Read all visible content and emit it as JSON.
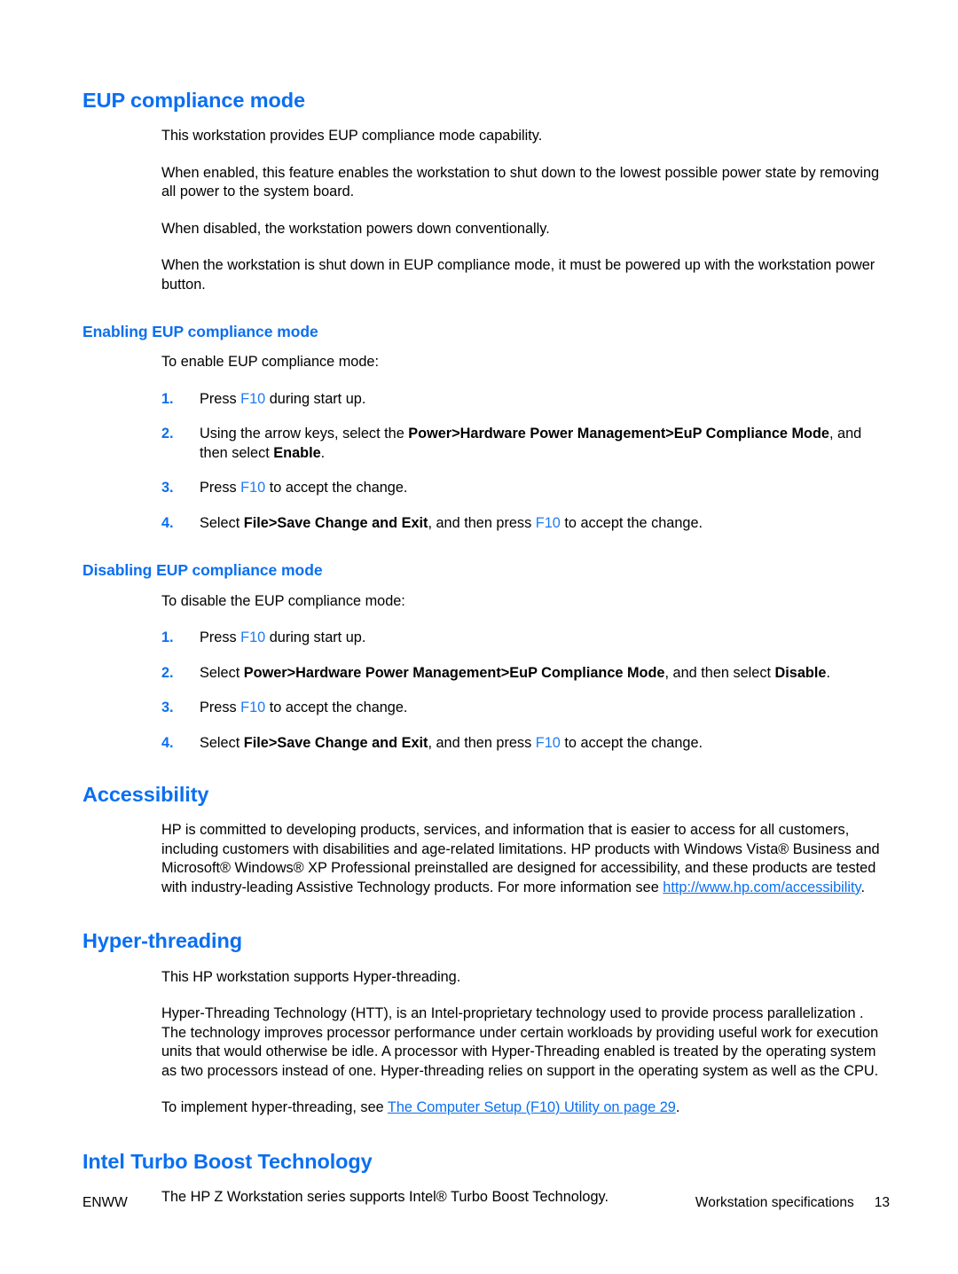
{
  "document": {
    "sections": [
      {
        "id": "eup-compliance-mode",
        "heading": "EUP compliance mode",
        "paragraphs": [
          "This workstation provides EUP compliance mode capability.",
          "When enabled, this feature enables the workstation to shut down to the lowest possible power state by removing all power to the system board.",
          "When disabled, the workstation powers down conventionally.",
          "When the workstation is shut down in EUP compliance mode, it must be powered up with the workstation power button."
        ]
      },
      {
        "id": "enabling-eup-compliance-mode",
        "heading": "Enabling EUP compliance mode",
        "intro": "To enable EUP compliance mode:",
        "steps": [
          {
            "num": "1.",
            "parts": [
              {
                "t": "Press "
              },
              {
                "t": "F10",
                "s": "key"
              },
              {
                "t": " during start up."
              }
            ]
          },
          {
            "num": "2.",
            "parts": [
              {
                "t": "Using the arrow keys, select the "
              },
              {
                "t": "Power>Hardware Power Management>EuP Compliance Mode",
                "s": "bold"
              },
              {
                "t": ", and then select "
              },
              {
                "t": "Enable",
                "s": "bold"
              },
              {
                "t": "."
              }
            ]
          },
          {
            "num": "3.",
            "parts": [
              {
                "t": "Press "
              },
              {
                "t": "F10",
                "s": "key"
              },
              {
                "t": " to accept the change."
              }
            ]
          },
          {
            "num": "4.",
            "parts": [
              {
                "t": "Select "
              },
              {
                "t": "File>Save Change and Exit",
                "s": "bold"
              },
              {
                "t": ", and then press "
              },
              {
                "t": "F10",
                "s": "key"
              },
              {
                "t": " to accept the change."
              }
            ]
          }
        ]
      },
      {
        "id": "disabling-eup-compliance-mode",
        "heading": "Disabling EUP compliance mode",
        "intro": "To disable the EUP compliance mode:",
        "steps": [
          {
            "num": "1.",
            "parts": [
              {
                "t": "Press "
              },
              {
                "t": "F10",
                "s": "key"
              },
              {
                "t": " during start up."
              }
            ]
          },
          {
            "num": "2.",
            "parts": [
              {
                "t": "Select "
              },
              {
                "t": "Power>Hardware Power Management>EuP Compliance Mode",
                "s": "bold"
              },
              {
                "t": ", and then select "
              },
              {
                "t": "Disable",
                "s": "bold"
              },
              {
                "t": "."
              }
            ]
          },
          {
            "num": "3.",
            "parts": [
              {
                "t": "Press "
              },
              {
                "t": "F10",
                "s": "key"
              },
              {
                "t": " to accept the change."
              }
            ]
          },
          {
            "num": "4.",
            "parts": [
              {
                "t": "Select "
              },
              {
                "t": "File>Save Change and Exit",
                "s": "bold"
              },
              {
                "t": ", and then press "
              },
              {
                "t": "F10",
                "s": "key"
              },
              {
                "t": " to accept the change."
              }
            ]
          }
        ]
      },
      {
        "id": "accessibility",
        "heading": "Accessibility",
        "paragraph_parts": [
          {
            "t": "HP is committed to developing products, services, and information that is easier to access for all customers, including customers with disabilities and age-related limitations. HP products with Windows Vista® Business and Microsoft® Windows® XP Professional preinstalled are designed for accessibility, and these products are tested with industry-leading Assistive Technology products. For more information see "
          },
          {
            "t": "http://www.hp.com/accessibility",
            "s": "link"
          },
          {
            "t": "."
          }
        ]
      },
      {
        "id": "hyper-threading",
        "heading": "Hyper-threading",
        "paragraphs": [
          "This HP workstation supports Hyper-threading.",
          "Hyper-Threading Technology (HTT), is an Intel-proprietary technology used to provide process parallelization . The technology improves processor performance under certain workloads by providing useful work for execution units that would otherwise be idle. A processor with Hyper-Threading enabled is treated by the operating system as two processors instead of one. Hyper-threading relies on support in the operating system as well as the CPU."
        ],
        "closing_parts": [
          {
            "t": "To implement hyper-threading, see "
          },
          {
            "t": "The Computer Setup (F10) Utility on page 29",
            "s": "link"
          },
          {
            "t": "."
          }
        ]
      },
      {
        "id": "intel-turbo-boost-technology",
        "heading": "Intel Turbo Boost Technology",
        "paragraphs": [
          "The HP Z Workstation series supports Intel® Turbo Boost Technology."
        ]
      }
    ]
  },
  "footer": {
    "left": "ENWW",
    "chapter": "Workstation specifications",
    "page_number": "13"
  },
  "colors": {
    "heading_blue": "#0b6ff0",
    "key_blue": "#1d7bf2",
    "link_blue": "#0b6ff0",
    "text_black": "#000000",
    "page_background": "#ffffff"
  }
}
